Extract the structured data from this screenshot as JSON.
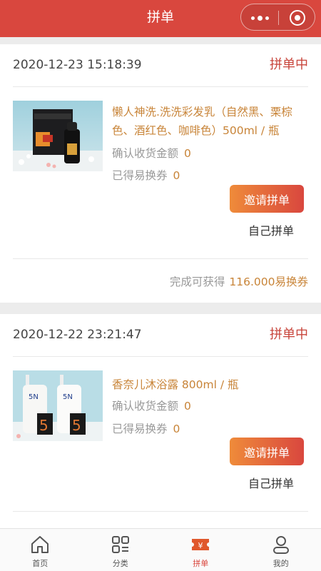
{
  "header": {
    "title": "拼单"
  },
  "orders": [
    {
      "time": "2020-12-23 15:18:39",
      "status": "拼单中",
      "product_name": "懒人神洗.洗洗彩发乳（自然黑、栗棕色、酒红色、咖啡色）500ml / 瓶",
      "confirm_label": "确认收货金额",
      "confirm_value": "0",
      "earned_label": "已得易换券",
      "earned_value": "0",
      "invite_label": "邀请拼单",
      "self_label": "自己拼单",
      "reward_prefix": "完成可获得",
      "reward_value": "116.000易换券"
    },
    {
      "time": "2020-12-22 23:21:47",
      "status": "拼单中",
      "product_name": "香奈儿沐浴露 800ml / 瓶",
      "confirm_label": "确认收货金额",
      "confirm_value": "0",
      "earned_label": "已得易换券",
      "earned_value": "0",
      "invite_label": "邀请拼单",
      "self_label": "自己拼单"
    }
  ],
  "tabs": [
    {
      "label": "首页",
      "icon": "home-icon"
    },
    {
      "label": "分类",
      "icon": "category-icon"
    },
    {
      "label": "拼单",
      "icon": "group-ticket-icon",
      "active": true
    },
    {
      "label": "我的",
      "icon": "user-icon"
    }
  ],
  "colors": {
    "primary": "#d9473e",
    "accent": "#c88438",
    "gradient_start": "#ef8b3a"
  }
}
